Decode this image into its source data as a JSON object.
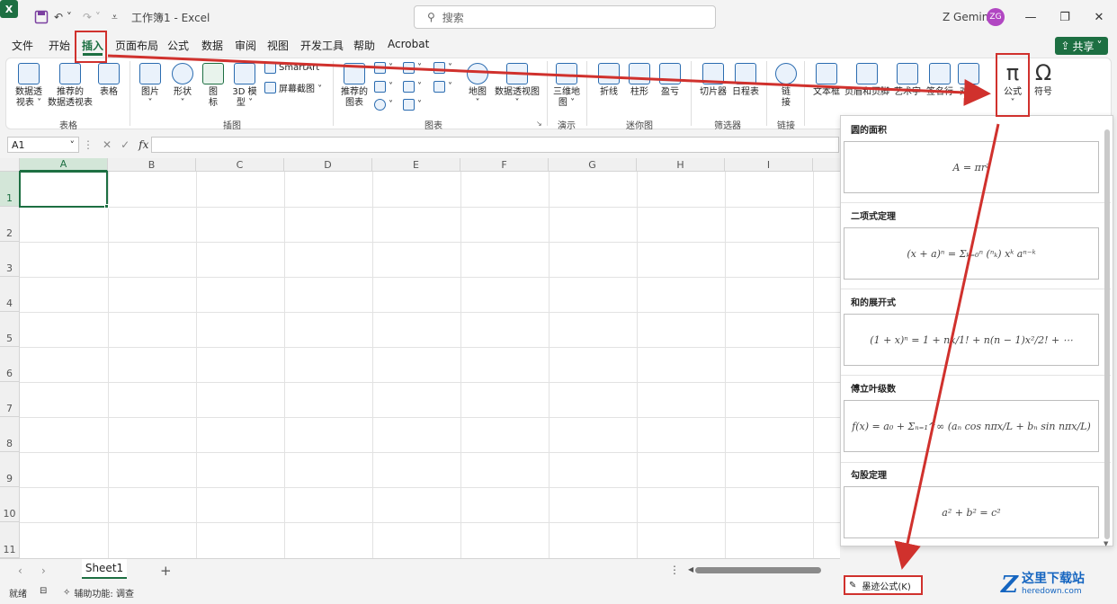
{
  "titlebar": {
    "app_logo": "X",
    "doc_title": "工作簿1  -  Excel",
    "search_placeholder": "搜索",
    "user_name": "Z Gemini",
    "avatar_initials": "ZG"
  },
  "menu": {
    "tabs": [
      "文件",
      "开始",
      "插入",
      "页面布局",
      "公式",
      "数据",
      "审阅",
      "视图",
      "开发工具",
      "帮助",
      "Acrobat"
    ],
    "active_tab": "插入",
    "share_label": "共享"
  },
  "ribbon": {
    "pivot": "数据透\n视表 ˅",
    "recommended_pivot": "推荐的\n数据透视表",
    "table": "表格",
    "group_tables": "表格",
    "pictures": "图片",
    "shapes": "形状",
    "icons": "图\n标",
    "model3d": "3D 模\n型 ˅",
    "smartart": "SmartArt",
    "screenshot": "屏幕截图 ˅",
    "group_illustrations": "插图",
    "recommended_charts": "推荐的\n图表",
    "maps": "地图",
    "pivot_chart": "数据透视图",
    "group_charts": "图表",
    "map3d": "三维地\n图 ˅",
    "group_tours": "演示",
    "line": "折线",
    "column": "柱形",
    "winloss": "盈亏",
    "group_sparklines": "迷你图",
    "slicer": "切片器",
    "timeline": "日程表",
    "group_filters": "筛选器",
    "link": "链\n接",
    "group_links": "链接",
    "textbox": "文本框",
    "header_footer": "页眉和页脚",
    "wordart": "艺术字",
    "signature": "签名行",
    "object": "对象",
    "equation": "公式",
    "symbol": "符号"
  },
  "formula_bar": {
    "name_box": "A1",
    "fx": "fx"
  },
  "grid": {
    "columns": [
      "A",
      "B",
      "C",
      "D",
      "E",
      "F",
      "G",
      "H",
      "I"
    ],
    "rows": [
      "1",
      "2",
      "3",
      "4",
      "5",
      "6",
      "7",
      "8",
      "9",
      "10",
      "11"
    ],
    "selected_cell": "A1"
  },
  "sheets": {
    "tabs": [
      "Sheet1"
    ],
    "add_label": "+"
  },
  "status": {
    "ready": "就绪",
    "accessibility": "辅助功能: 调查"
  },
  "equation_gallery": {
    "items": [
      {
        "title": "圆的面积",
        "formula": "A = πr²"
      },
      {
        "title": "二项式定理",
        "formula": "(x + a)ⁿ = Σₖ₌₀ⁿ (ⁿₖ) xᵏ aⁿ⁻ᵏ"
      },
      {
        "title": "和的展开式",
        "formula": "(1 + x)ⁿ = 1 + nx/1! + n(n − 1)x²/2! + ⋯"
      },
      {
        "title": "傅立叶级数",
        "formula": "f(x) = a₀ + Σₙ₌₁^∞ (aₙ cos nπx/L + bₙ sin nπx/L)"
      },
      {
        "title": "勾股定理",
        "formula": "a² + b² = c²"
      }
    ],
    "ink_equation": "墨迹公式(K)"
  },
  "watermark": {
    "logo": "Z",
    "cn": "这里下载站",
    "url": "heredown.com"
  },
  "colors": {
    "excel_green": "#1d6f42",
    "annotation_red": "#d0312d"
  }
}
